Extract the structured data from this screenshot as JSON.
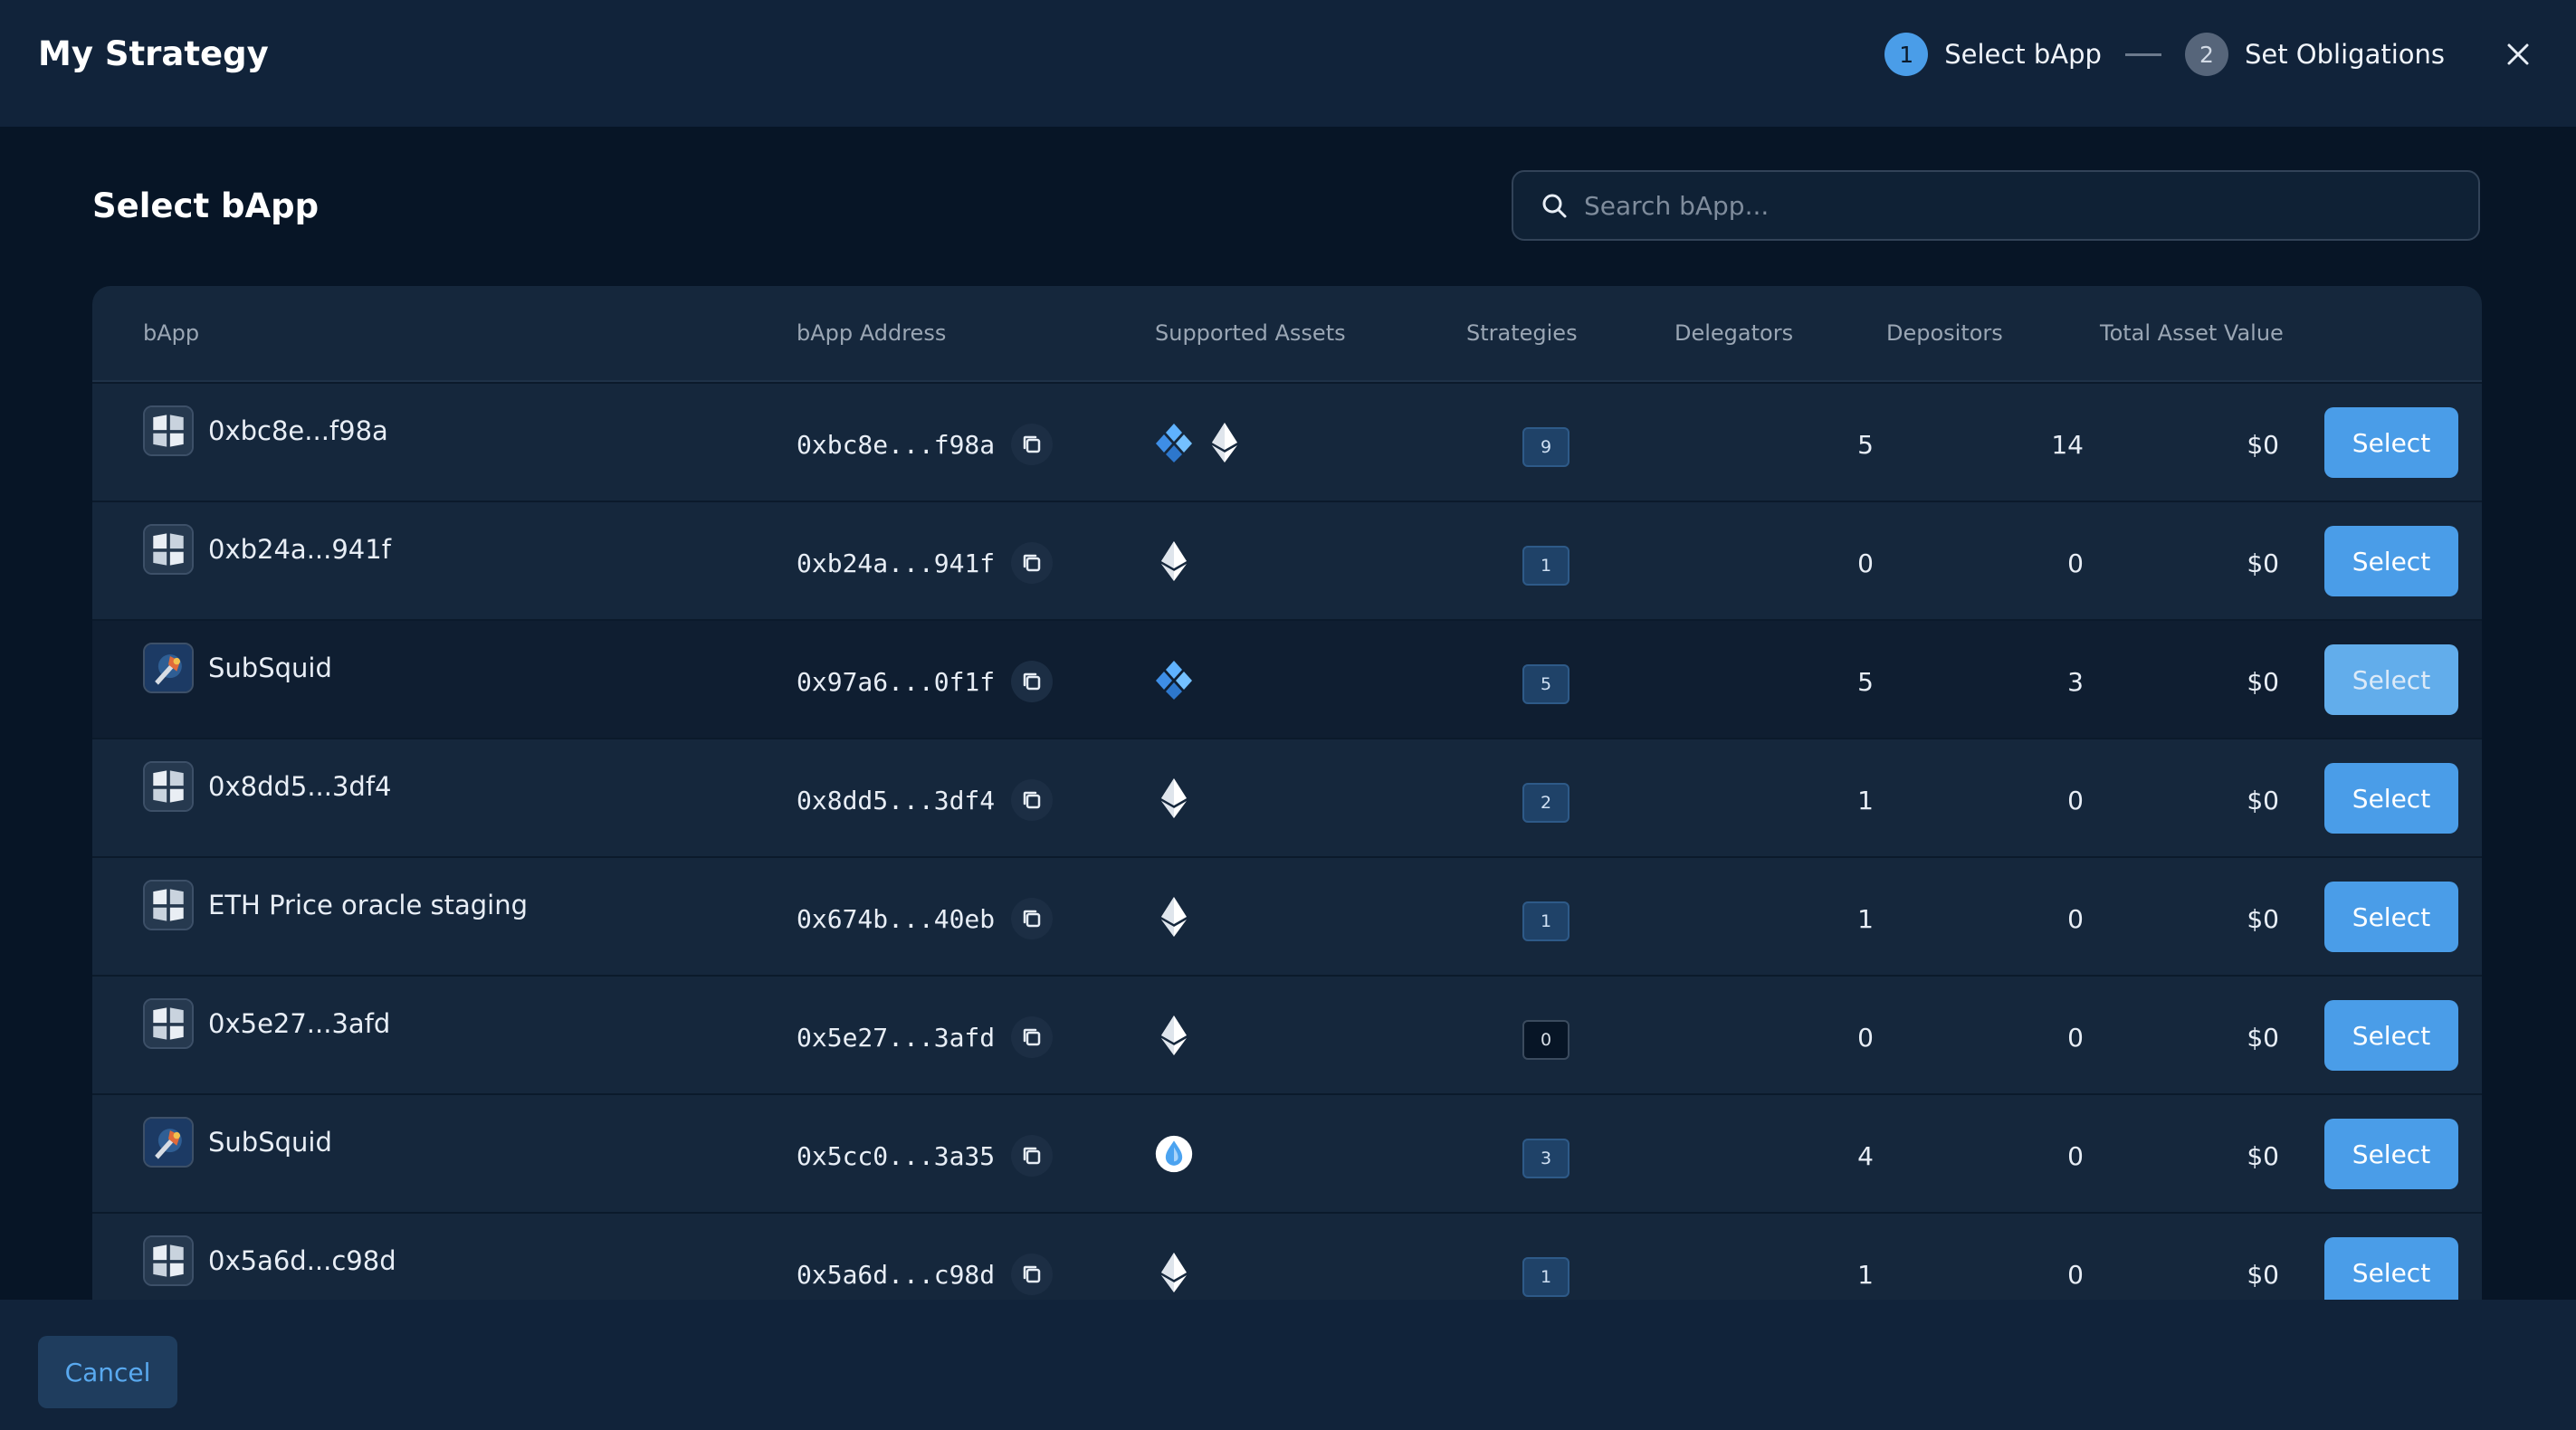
{
  "header": {
    "title": "My Strategy",
    "steps": [
      {
        "number": "1",
        "label": "Select bApp",
        "active": true
      },
      {
        "number": "2",
        "label": "Set Obligations",
        "active": false
      }
    ],
    "close_icon": "close-icon"
  },
  "section": {
    "title": "Select bApp"
  },
  "search": {
    "placeholder": "Search bApp..."
  },
  "table": {
    "columns": [
      "bApp",
      "bApp Address",
      "Supported Assets",
      "Strategies",
      "Delegators",
      "Depositors",
      "Total Asset Value"
    ],
    "rows": [
      {
        "name": "0xbc8e...f98a",
        "address": "0xbc8e...f98a",
        "assets": [
          "ssv-icon",
          "ethereum-icon"
        ],
        "strategies": "9",
        "delegators": "5",
        "depositors": "14",
        "total_value": "$0",
        "avatar": "bapp-default",
        "action": "Select"
      },
      {
        "name": "0xb24a...941f",
        "address": "0xb24a...941f",
        "assets": [
          "ethereum-icon"
        ],
        "strategies": "1",
        "delegators": "0",
        "depositors": "0",
        "total_value": "$0",
        "avatar": "bapp-default",
        "action": "Select"
      },
      {
        "name": "SubSquid",
        "address": "0x97a6...0f1f",
        "assets": [
          "ssv-icon"
        ],
        "strategies": "5",
        "delegators": "5",
        "depositors": "3",
        "total_value": "$0",
        "avatar": "subsquid",
        "action": "Select"
      },
      {
        "name": "0x8dd5...3df4",
        "address": "0x8dd5...3df4",
        "assets": [
          "ethereum-icon"
        ],
        "strategies": "2",
        "delegators": "1",
        "depositors": "0",
        "total_value": "$0",
        "avatar": "bapp-default",
        "action": "Select"
      },
      {
        "name": "ETH Price oracle staging",
        "address": "0x674b...40eb",
        "assets": [
          "ethereum-icon"
        ],
        "strategies": "1",
        "delegators": "1",
        "depositors": "0",
        "total_value": "$0",
        "avatar": "bapp-default",
        "action": "Select"
      },
      {
        "name": "0x5e27...3afd",
        "address": "0x5e27...3afd",
        "assets": [
          "ethereum-icon"
        ],
        "strategies": "0",
        "delegators": "0",
        "depositors": "0",
        "total_value": "$0",
        "avatar": "bapp-default",
        "action": "Select"
      },
      {
        "name": "SubSquid",
        "address": "0x5cc0...3a35",
        "assets": [
          "liquid-staking-drop-icon"
        ],
        "strategies": "3",
        "delegators": "4",
        "depositors": "0",
        "total_value": "$0",
        "avatar": "subsquid",
        "action": "Select"
      },
      {
        "name": "0x5a6d...c98d",
        "address": "0x5a6d...c98d",
        "assets": [
          "ethereum-icon"
        ],
        "strategies": "1",
        "delegators": "1",
        "depositors": "0",
        "total_value": "$0",
        "avatar": "bapp-default",
        "action": "Select"
      }
    ]
  },
  "footer": {
    "cancel_label": "Cancel"
  },
  "colors": {
    "accent": "#4a9de8",
    "background": "#071526",
    "panel": "#15273c",
    "header": "#11233a"
  }
}
